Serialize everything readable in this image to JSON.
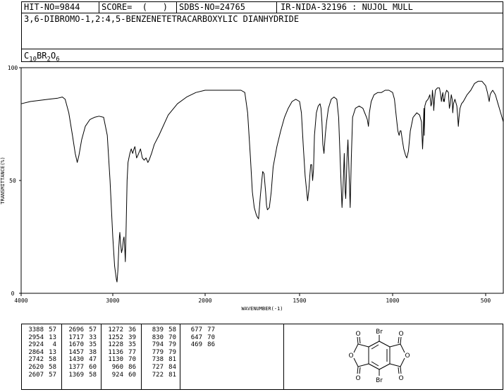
{
  "header": {
    "hit_no": "HIT-NO=9844",
    "score": "SCORE=  (   )",
    "sdbs_no": "SDBS-NO=24765",
    "ir_info": "IR-NIDA-32196 : NUJOL MULL"
  },
  "compound": {
    "name": "3,6-DIBROMO-1,2:4,5-BENZENETETRACARBOXYLIC DIANHYDRIDE",
    "formula_parts": [
      "C",
      "10",
      "BR",
      "2",
      "O",
      "6"
    ]
  },
  "chart_data": {
    "type": "line",
    "xlabel": "WAVENUMBER(-1)",
    "ylabel": "TRANSMITTANCE(%)",
    "xlim": [
      4000,
      400
    ],
    "ylim": [
      0,
      100
    ],
    "x_ticks": [
      4000,
      3000,
      2000,
      1500,
      1000,
      500
    ],
    "y_ticks": [
      0,
      50,
      100
    ],
    "x_tick_labels": [
      "4000",
      "3000",
      "2000",
      "1500",
      "1000",
      "500"
    ],
    "y_tick_labels": [
      "0",
      "50",
      "100"
    ],
    "grid": false,
    "series": [
      {
        "color": "#000000",
        "points": [
          [
            4000,
            84
          ],
          [
            3900,
            85
          ],
          [
            3800,
            85.5
          ],
          [
            3700,
            86
          ],
          [
            3600,
            86.5
          ],
          [
            3550,
            87
          ],
          [
            3520,
            86
          ],
          [
            3480,
            80
          ],
          [
            3440,
            70
          ],
          [
            3410,
            62
          ],
          [
            3388,
            58
          ],
          [
            3370,
            61
          ],
          [
            3340,
            68
          ],
          [
            3300,
            74
          ],
          [
            3250,
            77
          ],
          [
            3200,
            78
          ],
          [
            3150,
            78.5
          ],
          [
            3100,
            78
          ],
          [
            3060,
            70
          ],
          [
            3030,
            50
          ],
          [
            3000,
            25
          ],
          [
            2980,
            12
          ],
          [
            2960,
            6
          ],
          [
            2954,
            5
          ],
          [
            2945,
            10
          ],
          [
            2935,
            20
          ],
          [
            2928,
            25
          ],
          [
            2924,
            27
          ],
          [
            2915,
            22
          ],
          [
            2905,
            18
          ],
          [
            2895,
            20
          ],
          [
            2885,
            24
          ],
          [
            2878,
            25
          ],
          [
            2870,
            20
          ],
          [
            2864,
            14
          ],
          [
            2855,
            30
          ],
          [
            2845,
            50
          ],
          [
            2835,
            58
          ],
          [
            2815,
            62
          ],
          [
            2800,
            64
          ],
          [
            2785,
            62
          ],
          [
            2770,
            64
          ],
          [
            2760,
            65
          ],
          [
            2750,
            62
          ],
          [
            2742,
            60
          ],
          [
            2730,
            61
          ],
          [
            2720,
            62
          ],
          [
            2700,
            64
          ],
          [
            2680,
            60
          ],
          [
            2660,
            59
          ],
          [
            2640,
            60
          ],
          [
            2620,
            58
          ],
          [
            2607,
            59
          ],
          [
            2580,
            62
          ],
          [
            2550,
            66
          ],
          [
            2500,
            70
          ],
          [
            2400,
            79
          ],
          [
            2300,
            84
          ],
          [
            2200,
            87
          ],
          [
            2100,
            89
          ],
          [
            2000,
            90
          ],
          [
            1900,
            90
          ],
          [
            1850,
            90
          ],
          [
            1810,
            90
          ],
          [
            1790,
            89
          ],
          [
            1775,
            80
          ],
          [
            1760,
            60
          ],
          [
            1750,
            45
          ],
          [
            1740,
            38
          ],
          [
            1730,
            35
          ],
          [
            1725,
            34
          ],
          [
            1717,
            33
          ],
          [
            1708,
            43
          ],
          [
            1700,
            50
          ],
          [
            1695,
            54
          ],
          [
            1688,
            53
          ],
          [
            1680,
            45
          ],
          [
            1675,
            39
          ],
          [
            1670,
            37
          ],
          [
            1660,
            38
          ],
          [
            1650,
            45
          ],
          [
            1640,
            56
          ],
          [
            1620,
            65
          ],
          [
            1600,
            72
          ],
          [
            1580,
            78
          ],
          [
            1560,
            82
          ],
          [
            1540,
            85
          ],
          [
            1520,
            86
          ],
          [
            1500,
            85
          ],
          [
            1490,
            80
          ],
          [
            1480,
            65
          ],
          [
            1470,
            52
          ],
          [
            1457,
            41
          ],
          [
            1450,
            46
          ],
          [
            1445,
            52
          ],
          [
            1440,
            57
          ],
          [
            1435,
            57
          ],
          [
            1430,
            50
          ],
          [
            1425,
            55
          ],
          [
            1420,
            70
          ],
          [
            1410,
            80
          ],
          [
            1400,
            83
          ],
          [
            1390,
            84
          ],
          [
            1385,
            82
          ],
          [
            1380,
            76
          ],
          [
            1375,
            66
          ],
          [
            1369,
            62
          ],
          [
            1362,
            70
          ],
          [
            1355,
            76
          ],
          [
            1345,
            82
          ],
          [
            1330,
            86
          ],
          [
            1315,
            87
          ],
          [
            1300,
            86
          ],
          [
            1290,
            78
          ],
          [
            1280,
            55
          ],
          [
            1272,
            38
          ],
          [
            1266,
            48
          ],
          [
            1260,
            62
          ],
          [
            1255,
            45
          ],
          [
            1252,
            42
          ],
          [
            1245,
            60
          ],
          [
            1240,
            68
          ],
          [
            1235,
            55
          ],
          [
            1228,
            38
          ],
          [
            1222,
            60
          ],
          [
            1215,
            78
          ],
          [
            1200,
            82
          ],
          [
            1180,
            83
          ],
          [
            1160,
            82
          ],
          [
            1150,
            80
          ],
          [
            1140,
            78
          ],
          [
            1136,
            77
          ],
          [
            1130,
            74
          ],
          [
            1125,
            80
          ],
          [
            1115,
            85
          ],
          [
            1100,
            88
          ],
          [
            1080,
            89
          ],
          [
            1060,
            89
          ],
          [
            1040,
            90
          ],
          [
            1020,
            90
          ],
          [
            1000,
            89
          ],
          [
            990,
            86
          ],
          [
            980,
            78
          ],
          [
            972,
            72
          ],
          [
            965,
            70
          ],
          [
            960,
            72
          ],
          [
            955,
            72
          ],
          [
            948,
            68
          ],
          [
            940,
            64
          ],
          [
            930,
            61
          ],
          [
            924,
            60
          ],
          [
            915,
            63
          ],
          [
            905,
            72
          ],
          [
            890,
            78
          ],
          [
            870,
            80
          ],
          [
            855,
            79
          ],
          [
            845,
            76
          ],
          [
            839,
            64
          ],
          [
            836,
            70
          ],
          [
            832,
            82
          ],
          [
            830,
            70
          ],
          [
            827,
            83
          ],
          [
            820,
            85
          ],
          [
            810,
            86
          ],
          [
            800,
            88
          ],
          [
            794,
            83
          ],
          [
            790,
            84
          ],
          [
            786,
            90
          ],
          [
            780,
            84
          ],
          [
            779,
            81
          ],
          [
            775,
            86
          ],
          [
            770,
            90
          ],
          [
            760,
            91
          ],
          [
            748,
            91
          ],
          [
            742,
            88
          ],
          [
            738,
            85
          ],
          [
            735,
            87
          ],
          [
            730,
            89
          ],
          [
            727,
            85
          ],
          [
            724,
            86
          ],
          [
            722,
            85
          ],
          [
            718,
            88
          ],
          [
            710,
            90
          ],
          [
            700,
            89
          ],
          [
            695,
            82
          ],
          [
            690,
            84
          ],
          [
            685,
            88
          ],
          [
            680,
            86
          ],
          [
            677,
            80
          ],
          [
            673,
            84
          ],
          [
            665,
            86
          ],
          [
            655,
            83
          ],
          [
            650,
            78
          ],
          [
            647,
            74
          ],
          [
            643,
            78
          ],
          [
            638,
            82
          ],
          [
            630,
            84
          ],
          [
            620,
            85
          ],
          [
            600,
            88
          ],
          [
            580,
            90
          ],
          [
            560,
            93
          ],
          [
            540,
            94
          ],
          [
            520,
            94
          ],
          [
            500,
            92
          ],
          [
            490,
            89
          ],
          [
            480,
            85
          ],
          [
            475,
            88
          ],
          [
            469,
            89
          ],
          [
            460,
            90
          ],
          [
            445,
            88
          ],
          [
            430,
            84
          ],
          [
            415,
            80
          ],
          [
            400,
            76
          ]
        ]
      }
    ]
  },
  "peak_table": [
    {
      "wn": [
        "3388",
        "2954",
        "2924",
        "2864",
        "2742",
        "2620",
        "2607"
      ],
      "t": [
        "57",
        "13",
        "4",
        "13",
        "58",
        "58",
        "57"
      ]
    },
    {
      "wn": [
        "2696",
        "1717",
        "1670",
        "1457",
        "1430",
        "1377",
        "1369"
      ],
      "t": [
        "57",
        "33",
        "35",
        "38",
        "47",
        "60",
        "58"
      ]
    },
    {
      "wn": [
        "1272",
        "1252",
        "1228",
        "1136",
        "1130",
        "960",
        "924"
      ],
      "t": [
        "36",
        "39",
        "35",
        "77",
        "70",
        "86",
        "60"
      ]
    },
    {
      "wn": [
        "839",
        "830",
        "794",
        "779",
        "738",
        "727",
        "722"
      ],
      "t": [
        "58",
        "70",
        "79",
        "79",
        "81",
        "84",
        "81"
      ]
    },
    {
      "wn": [
        "677",
        "647",
        "469"
      ],
      "t": [
        "77",
        "70",
        "86"
      ]
    }
  ],
  "structure": {
    "atom_o": "O",
    "atom_br": "Br"
  }
}
